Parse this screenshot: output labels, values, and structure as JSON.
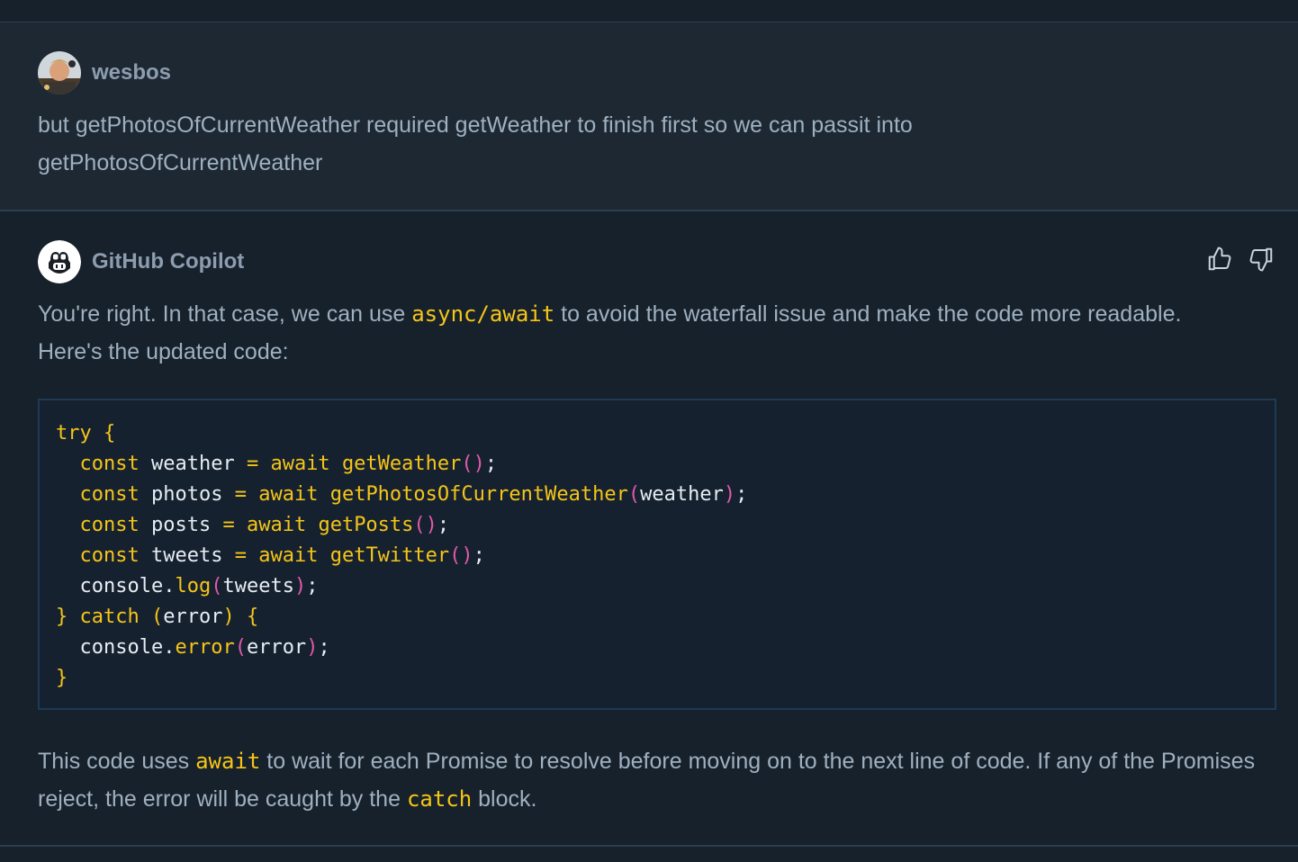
{
  "user_message": {
    "author": "wesbos",
    "text": "but getPhotosOfCurrentWeather required getWeather to finish first so we can passit into getPhotosOfCurrentWeather"
  },
  "copilot_message": {
    "author": "GitHub Copilot",
    "intro_before": "You're right. In that case, we can use ",
    "intro_code": "async/await",
    "intro_after": " to avoid the waterfall issue and make the code more readable. Here's the updated code:",
    "outro_1": "This code uses ",
    "outro_code_1": "await",
    "outro_2": " to wait for each Promise to resolve before moving on to the next line of code. If any of the Promises reject, the error will be caught by the ",
    "outro_code_2": "catch",
    "outro_3": " block.",
    "feedback": {
      "thumbs_up_icon": "thumbs-up-icon",
      "thumbs_down_icon": "thumbs-down-icon"
    }
  },
  "code": {
    "kw_try": "try",
    "kw_const": "const",
    "kw_await": "await",
    "kw_catch": "catch",
    "var_weather": "weather",
    "var_photos": "photos",
    "var_posts": "posts",
    "var_tweets": "tweets",
    "var_error": "error",
    "fn_getWeather": "getWeather",
    "fn_getPhotos": "getPhotosOfCurrentWeather",
    "fn_getPosts": "getPosts",
    "fn_getTwitter": "getTwitter",
    "obj_console": "console",
    "m_log": "log",
    "m_error": "error"
  },
  "colors": {
    "accent_yellow": "#f5c518",
    "accent_pink": "#e05aa8",
    "background": "#17212b",
    "user_background": "#1d2833"
  }
}
